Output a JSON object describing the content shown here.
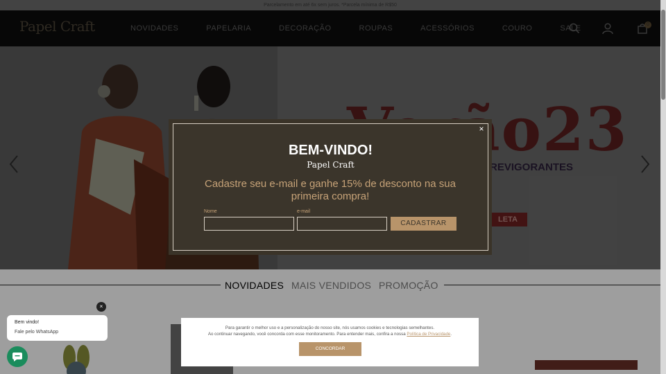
{
  "topbar": {
    "text": "Parcelamento em até 6x sem juros. *Parcela mínima de R$50"
  },
  "header": {
    "logo": "Papel Craft",
    "nav": [
      "NOVIDADES",
      "PAPELARIA",
      "DECORAÇÃO",
      "ROUPAS",
      "ACESSÓRIOS",
      "COURO",
      "SALE"
    ],
    "icons": [
      "search-icon",
      "user-icon",
      "bag-icon"
    ],
    "cart_count": "0"
  },
  "hero": {
    "title": "Verão23",
    "subtitle": "REVIGORANTES",
    "button": "LETA"
  },
  "tabs": [
    "NOVIDADES",
    "MAIS VENDIDOS",
    "PROMOÇÃO"
  ],
  "modal": {
    "close": "×",
    "title": "BEM-VINDO!",
    "brand": "Papel Craft",
    "offer": "Cadastre seu e-mail e ganhe 15% de desconto na sua primeira compra!",
    "name_label": "Nome",
    "email_label": "e-mail",
    "name_value": "",
    "email_value": "",
    "submit": "CADASTRAR"
  },
  "chat": {
    "close": "×",
    "title": "Bem vindo!",
    "text": "Fale pelo WhatsApp"
  },
  "cookie": {
    "line1": "Para garantir o melhor uso e a personalização do nosso site, nós usamos cookies e tecnologias semelhantes.",
    "line2": "Ao continuar navegando, você concorda com esse monitoramento. Para entender mais, confira a nossa ",
    "link": "Política de Privacidade",
    "end": ".",
    "button": "CONCORDAR"
  },
  "colors": {
    "accent": "#b8946a",
    "modal_bg": "#3b352b",
    "header_bg": "#0c0c0c",
    "chat_green": "#1a8c5c"
  }
}
